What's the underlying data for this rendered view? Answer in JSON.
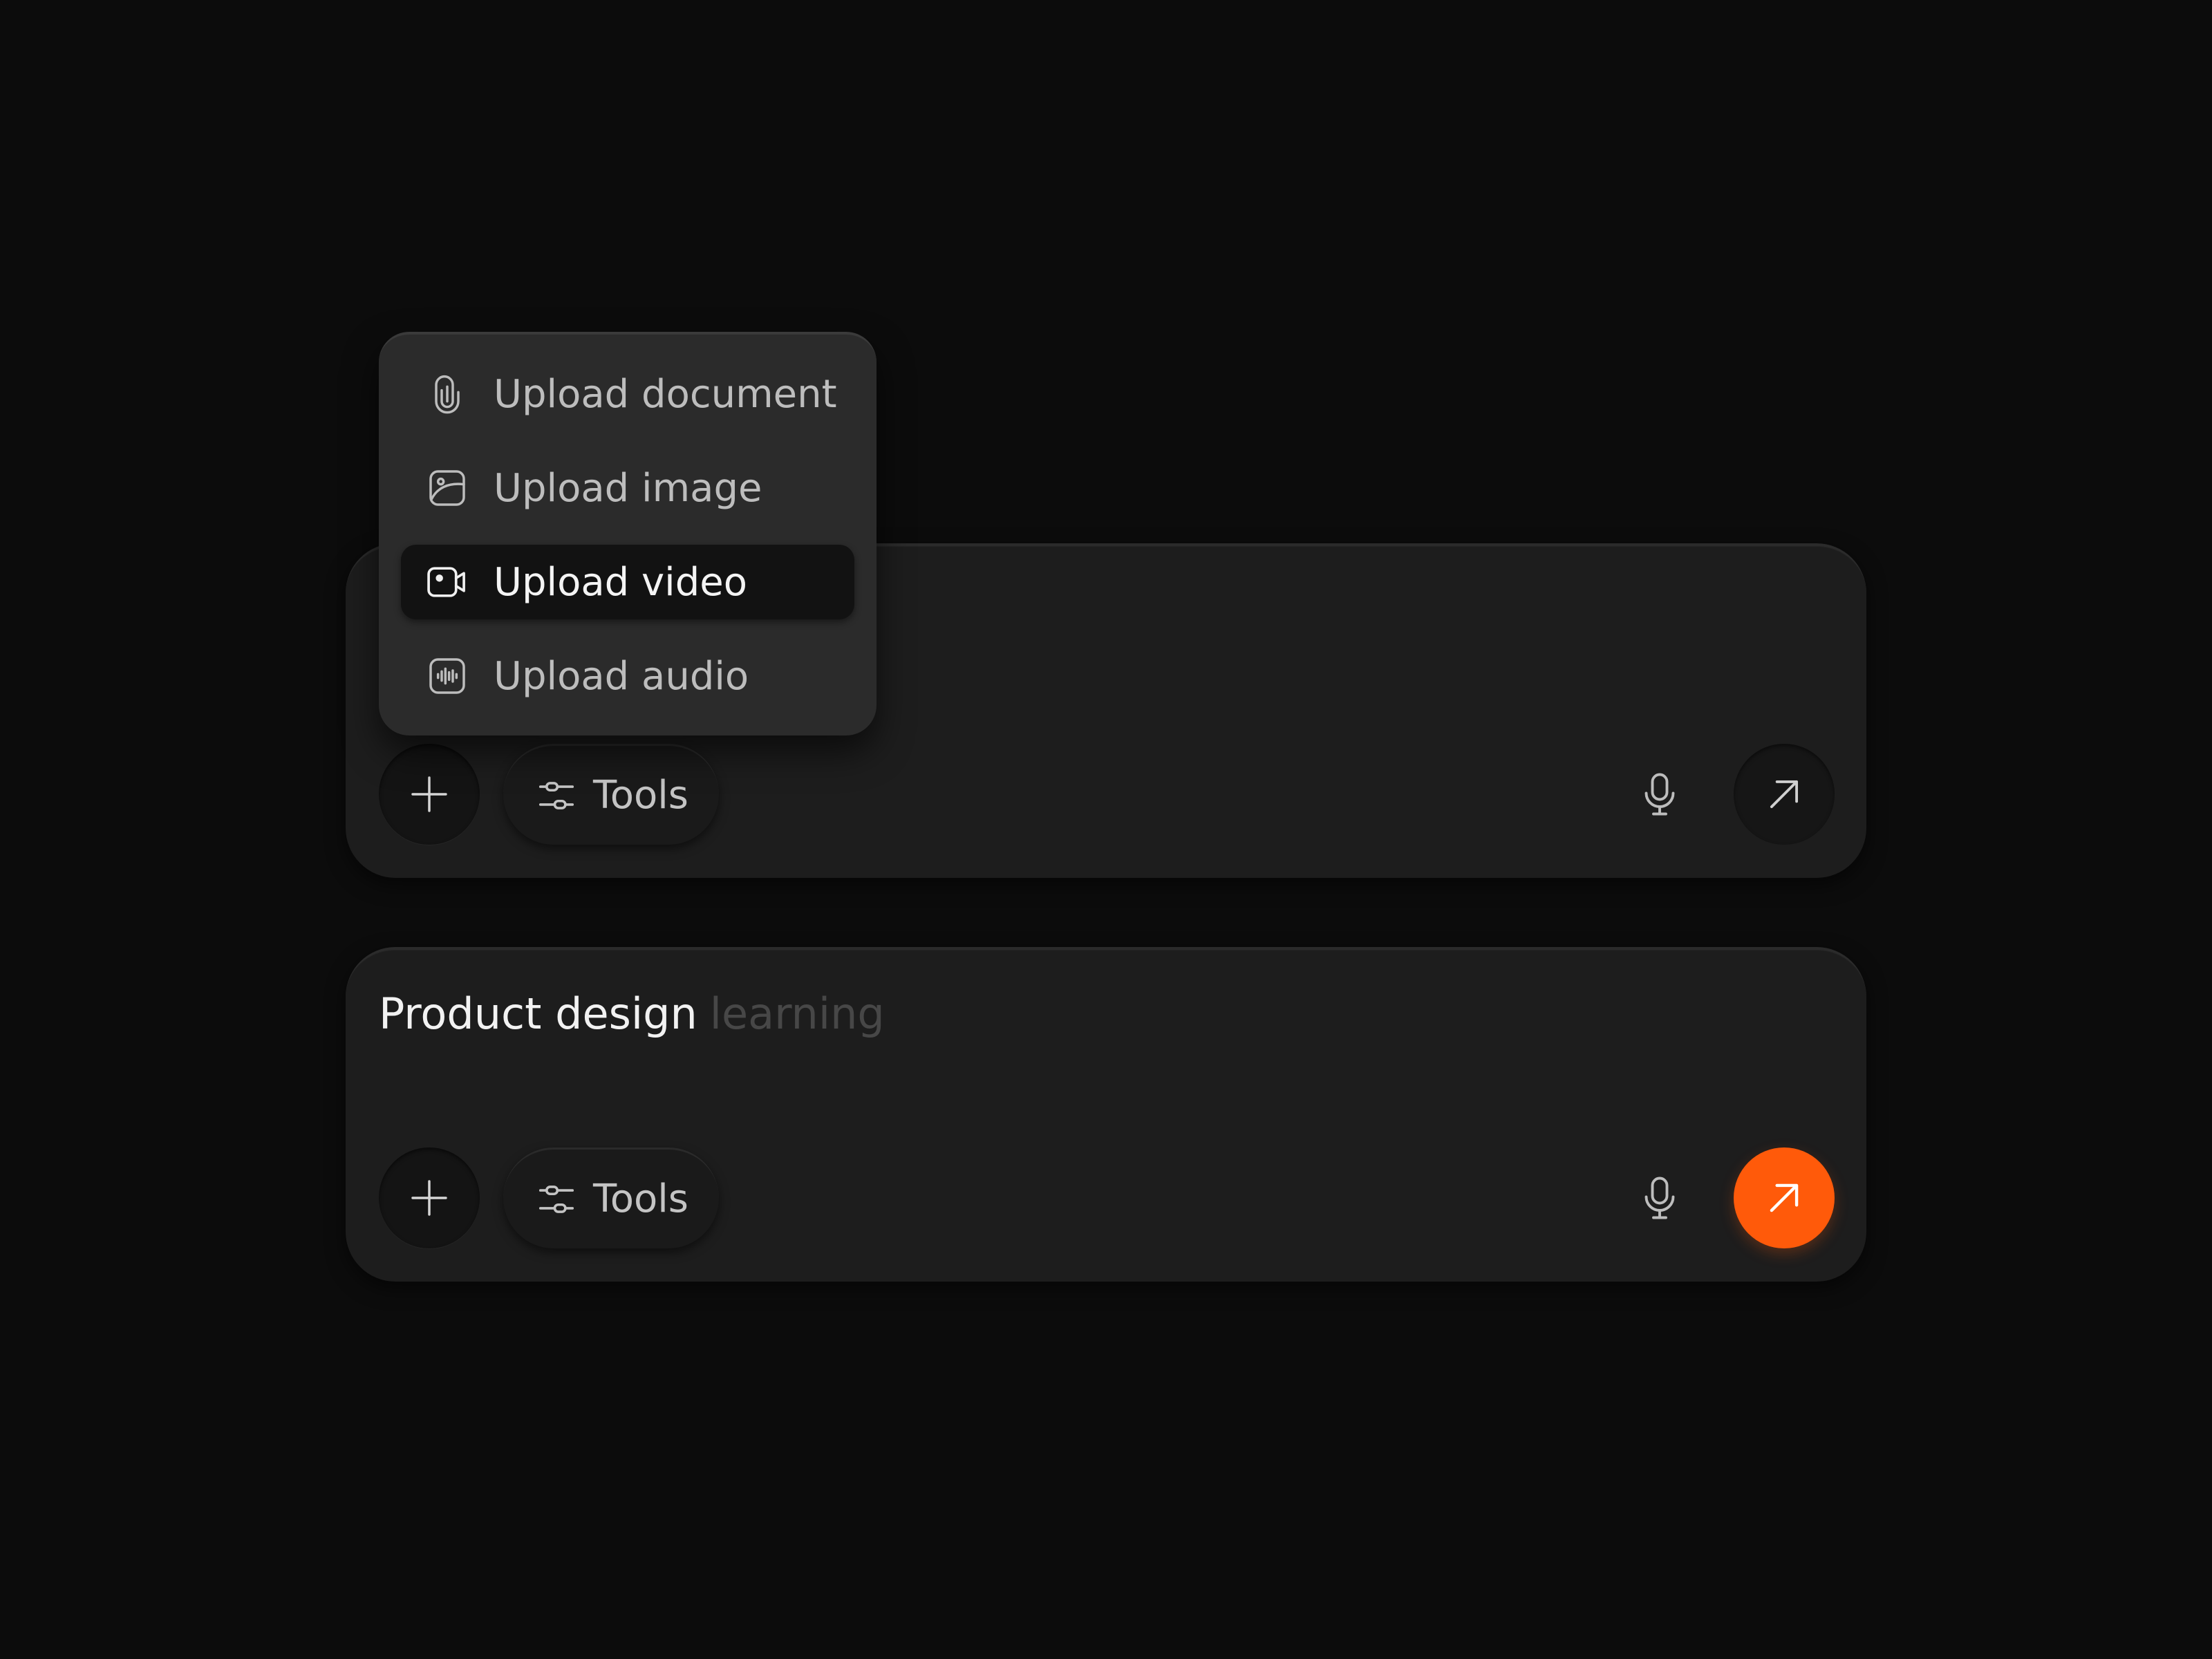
{
  "composer_top": {
    "tools_label": "Tools",
    "icons": {
      "add": "plus-icon",
      "tools": "sliders-icon",
      "mic": "microphone-icon",
      "send": "arrow-up-right-icon"
    },
    "send_state": "inactive"
  },
  "composer_bottom": {
    "prompt_typed": "Product design",
    "prompt_suggestion": "learning",
    "tools_label": "Tools",
    "icons": {
      "add": "plus-icon",
      "tools": "sliders-icon",
      "mic": "microphone-icon",
      "send": "arrow-up-right-icon"
    },
    "send_state": "active"
  },
  "upload_menu": {
    "items": [
      {
        "label": "Upload document",
        "icon": "paperclip-icon",
        "selected": false
      },
      {
        "label": "Upload image",
        "icon": "image-icon",
        "selected": false
      },
      {
        "label": "Upload video",
        "icon": "video-camera-icon",
        "selected": true
      },
      {
        "label": "Upload audio",
        "icon": "audio-wave-icon",
        "selected": false
      }
    ]
  },
  "colors": {
    "background": "#0c0c0c",
    "card": "#1d1d1d",
    "menu": "#2b2b2b",
    "accent": "#ff5a0a",
    "text_primary": "#f2f2f2",
    "text_secondary": "#bdbdbd",
    "text_suggestion": "#474747"
  }
}
